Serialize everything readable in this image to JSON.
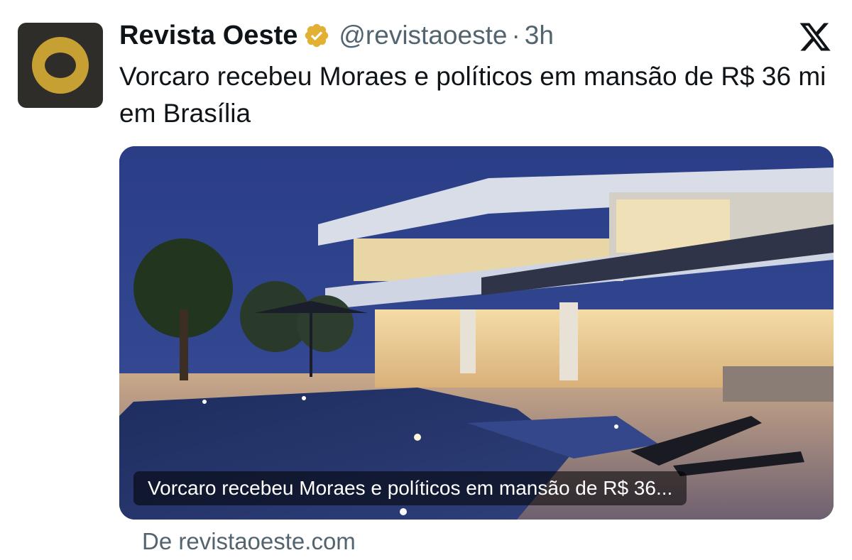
{
  "tweet": {
    "author_name": "Revista Oeste",
    "handle": "@revistaoeste",
    "separator": "·",
    "time": "3h",
    "text": "Vorcaro recebeu Moraes e políticos em mansão de R$ 36 mi em Brasília"
  },
  "card": {
    "title": "Vorcaro recebeu Moraes e políticos em mansão de R$ 36...",
    "source": "De revistaoeste.com"
  },
  "icons": {
    "avatar": "revista-oeste-logo",
    "verified": "verified-badge-icon",
    "platform": "x-logo-icon"
  },
  "colors": {
    "verified_badge": "#e2b033",
    "secondary_text": "#536471",
    "logo_gold": "#c7a033",
    "logo_dark": "#2f2d2a"
  }
}
